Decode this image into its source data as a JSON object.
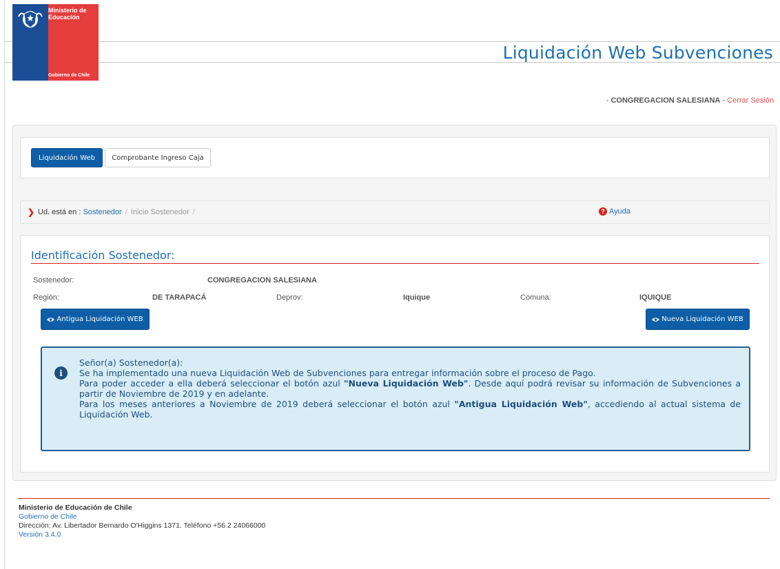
{
  "logo": {
    "title": "Ministerio de Educación",
    "footer": "Gobierno de Chile"
  },
  "header": {
    "app_title": "Liquidación Web Subvenciones"
  },
  "session": {
    "prefix": "- ",
    "user": "CONGREGACION SALESIANA",
    "separator": " - ",
    "logout": "Cerrar Sesión"
  },
  "tabs": [
    {
      "label": "Liquidación Web",
      "active": true
    },
    {
      "label": "Comprobante Ingreso Caja",
      "active": false
    }
  ],
  "breadcrumb": {
    "prefix": "Ud. está en :",
    "link": "Sostenedor",
    "separator": "/",
    "current": "Inicio Sostenedor",
    "help": "Ayuda"
  },
  "identification": {
    "title": "Identificación Sostenedor:",
    "sostenedor_label": "Sostenedor:",
    "sostenedor_value": "CONGREGACION SALESIANA",
    "region_label": "Región:",
    "region_value": "DE TARAPACÁ",
    "deprov_label": "Deprov:",
    "deprov_value": "Iquique",
    "comuna_label": "Comuna:",
    "comuna_value": "IQUIQUE",
    "old_button": "Antigua Liquidación WEB",
    "new_button": "Nueva Liquidación WEB"
  },
  "info": {
    "greeting": "Señor(a) Sostenedor(a):",
    "line1": "Se ha implementado una nueva Liquidación Web de Subvenciones para entregar información sobre el proceso de Pago.",
    "line2_a": "Para poder acceder a ella deberá seleccionar el botón azul ",
    "line2_bold": "\"Nueva Liquidación Web\"",
    "line2_b": ". Desde aquí podrá revisar su información de Subvenciones a partir de Noviembre de 2019 y en adelante.",
    "line3_a": "Para los meses anteriores a Noviembre de 2019 deberá seleccionar el botón azul ",
    "line3_bold": "\"Antigua Liquidación Web\"",
    "line3_b": ", accediendo al actual sistema de Liquidación Web."
  },
  "footer": {
    "org": "Ministerio de Educación de Chile",
    "gov": "Gobierno de Chile",
    "address": "Dirección: Av. Libertador Bernardo O'Higgins 1371. Teléfono +56 2 24066000",
    "version": "Versión 3.4.0"
  },
  "colors": {
    "primary": "#0d5ea6",
    "accent_red": "#d9251c",
    "title_blue": "#1e6fb5",
    "info_bg": "#d9edf7"
  }
}
